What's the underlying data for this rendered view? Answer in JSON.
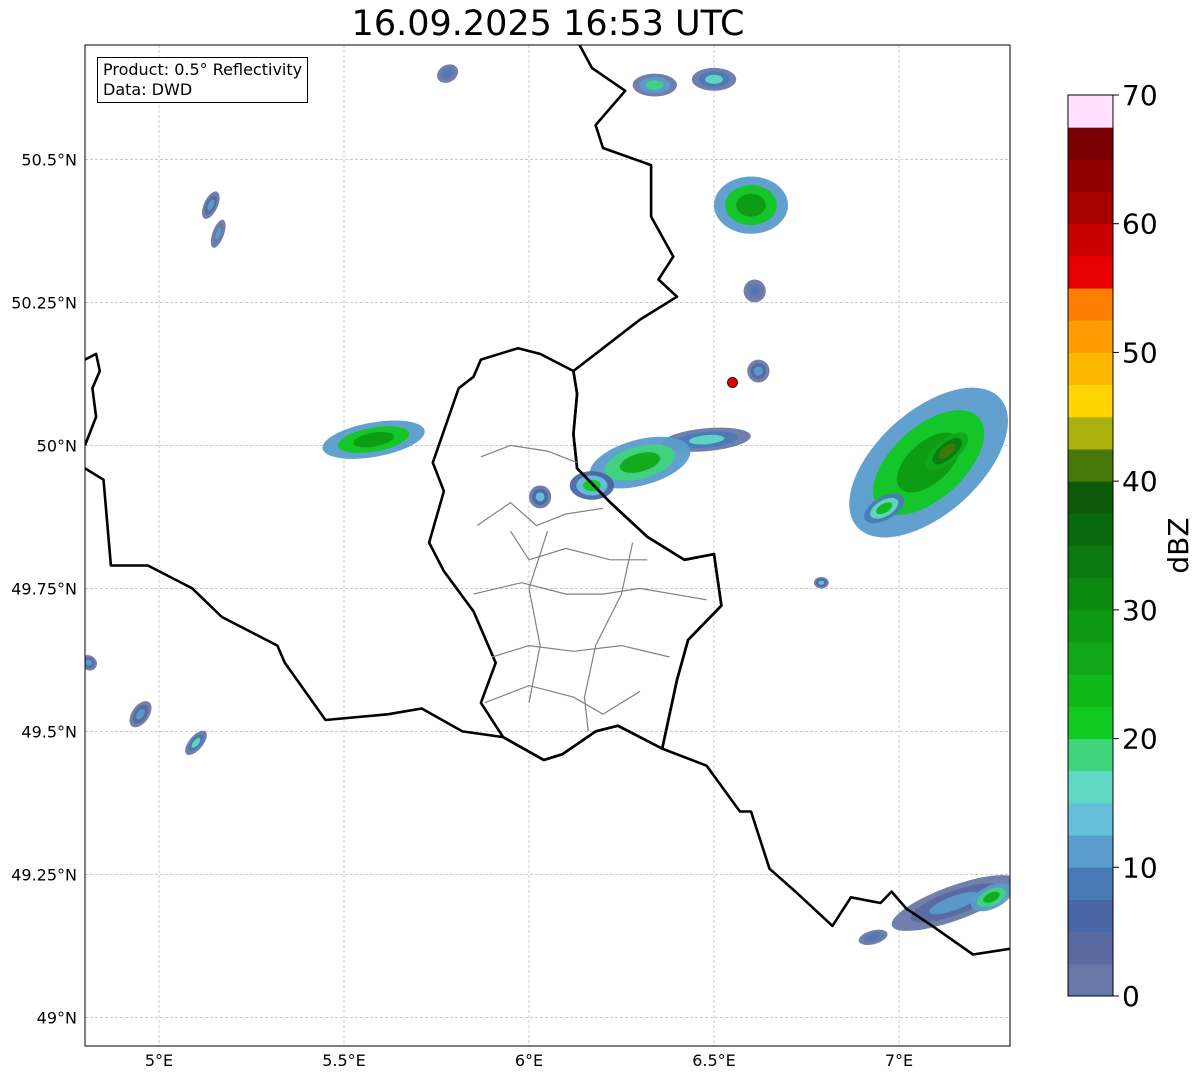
{
  "title": "16.09.2025 16:53 UTC",
  "info": {
    "product_line": "Product: 0.5° Reflectivity",
    "data_line": "Data: DWD"
  },
  "map": {
    "lon_range": [
      4.8,
      7.3
    ],
    "lat_range": [
      48.95,
      50.7
    ],
    "lat_ticks": [
      {
        "value": 49.0,
        "label": "49°N"
      },
      {
        "value": 49.25,
        "label": "49.25°N"
      },
      {
        "value": 49.5,
        "label": "49.5°N"
      },
      {
        "value": 49.75,
        "label": "49.75°N"
      },
      {
        "value": 50.0,
        "label": "50°N"
      },
      {
        "value": 50.25,
        "label": "50.25°N"
      },
      {
        "value": 50.5,
        "label": "50.5°N"
      }
    ],
    "lon_ticks": [
      {
        "value": 5.0,
        "label": "5°E"
      },
      {
        "value": 5.5,
        "label": "5.5°E"
      },
      {
        "value": 6.0,
        "label": "6°E"
      },
      {
        "value": 6.5,
        "label": "6.5°E"
      },
      {
        "value": 7.0,
        "label": "7°E"
      }
    ],
    "radar_site": {
      "lon": 6.55,
      "lat": 50.11,
      "color": "#e00000"
    },
    "echoes": [
      {
        "lon": 5.78,
        "lat": 50.65,
        "rx": 0.03,
        "ry": 0.015,
        "angle": -30,
        "dbz": 8
      },
      {
        "lon": 6.34,
        "lat": 50.63,
        "rx": 0.06,
        "ry": 0.02,
        "angle": 0,
        "dbz": 18
      },
      {
        "lon": 6.5,
        "lat": 50.64,
        "rx": 0.06,
        "ry": 0.02,
        "angle": 0,
        "dbz": 16
      },
      {
        "lon": 5.14,
        "lat": 50.42,
        "rx": 0.04,
        "ry": 0.012,
        "angle": -65,
        "dbz": 12
      },
      {
        "lon": 5.16,
        "lat": 50.37,
        "rx": 0.04,
        "ry": 0.01,
        "angle": -70,
        "dbz": 10
      },
      {
        "lon": 6.6,
        "lat": 50.42,
        "rx": 0.1,
        "ry": 0.05,
        "angle": 0,
        "dbz": 28
      },
      {
        "lon": 6.61,
        "lat": 50.27,
        "rx": 0.03,
        "ry": 0.02,
        "angle": 0,
        "dbz": 8
      },
      {
        "lon": 6.62,
        "lat": 50.13,
        "rx": 0.03,
        "ry": 0.02,
        "angle": 0,
        "dbz": 12
      },
      {
        "lon": 5.58,
        "lat": 50.01,
        "rx": 0.14,
        "ry": 0.03,
        "angle": -10,
        "dbz": 28
      },
      {
        "lon": 6.48,
        "lat": 50.01,
        "rx": 0.12,
        "ry": 0.02,
        "angle": -5,
        "dbz": 16
      },
      {
        "lon": 6.3,
        "lat": 49.97,
        "rx": 0.14,
        "ry": 0.04,
        "angle": -15,
        "dbz": 26
      },
      {
        "lon": 6.03,
        "lat": 49.91,
        "rx": 0.03,
        "ry": 0.02,
        "angle": 0,
        "dbz": 14
      },
      {
        "lon": 6.17,
        "lat": 49.93,
        "rx": 0.06,
        "ry": 0.025,
        "angle": 0,
        "dbz": 22
      },
      {
        "lon": 7.08,
        "lat": 49.97,
        "rx": 0.26,
        "ry": 0.09,
        "angle": -42,
        "dbz": 28
      },
      {
        "lon": 7.13,
        "lat": 49.99,
        "rx": 0.07,
        "ry": 0.02,
        "angle": -40,
        "dbz": 42
      },
      {
        "lon": 6.96,
        "lat": 49.89,
        "rx": 0.06,
        "ry": 0.02,
        "angle": -30,
        "dbz": 24
      },
      {
        "lon": 6.79,
        "lat": 49.76,
        "rx": 0.02,
        "ry": 0.01,
        "angle": 0,
        "dbz": 14
      },
      {
        "lon": 4.81,
        "lat": 49.62,
        "rx": 0.02,
        "ry": 0.015,
        "angle": -60,
        "dbz": 12
      },
      {
        "lon": 4.95,
        "lat": 49.53,
        "rx": 0.04,
        "ry": 0.015,
        "angle": -55,
        "dbz": 12
      },
      {
        "lon": 5.1,
        "lat": 49.48,
        "rx": 0.04,
        "ry": 0.012,
        "angle": -50,
        "dbz": 16
      },
      {
        "lon": 7.15,
        "lat": 49.2,
        "rx": 0.18,
        "ry": 0.03,
        "angle": -20,
        "dbz": 12
      },
      {
        "lon": 7.25,
        "lat": 49.21,
        "rx": 0.06,
        "ry": 0.02,
        "angle": -25,
        "dbz": 26
      },
      {
        "lon": 6.93,
        "lat": 49.14,
        "rx": 0.04,
        "ry": 0.012,
        "angle": -15,
        "dbz": 8
      }
    ],
    "country_borders": [
      [
        [
          6.12,
          50.72
        ],
        [
          6.17,
          50.66
        ],
        [
          6.26,
          50.62
        ],
        [
          6.18,
          50.56
        ],
        [
          6.2,
          50.52
        ],
        [
          6.33,
          50.49
        ],
        [
          6.33,
          50.4
        ],
        [
          6.39,
          50.33
        ],
        [
          6.35,
          50.29
        ],
        [
          6.4,
          50.26
        ],
        [
          6.3,
          50.22
        ],
        [
          6.2,
          50.17
        ],
        [
          6.12,
          50.13
        ],
        [
          6.13,
          50.09
        ],
        [
          6.12,
          50.02
        ],
        [
          6.13,
          49.96
        ],
        [
          6.22,
          49.9
        ],
        [
          6.32,
          49.84
        ],
        [
          6.42,
          49.8
        ],
        [
          6.5,
          49.81
        ],
        [
          6.52,
          49.72
        ],
        [
          6.43,
          49.66
        ],
        [
          6.4,
          49.59
        ],
        [
          6.36,
          49.47
        ],
        [
          6.48,
          49.44
        ],
        [
          6.57,
          49.36
        ],
        [
          6.6,
          49.36
        ],
        [
          6.65,
          49.26
        ],
        [
          6.72,
          49.22
        ],
        [
          6.82,
          49.16
        ],
        [
          6.87,
          49.21
        ],
        [
          6.95,
          49.2
        ],
        [
          6.98,
          49.22
        ],
        [
          7.02,
          49.19
        ],
        [
          7.09,
          49.16
        ],
        [
          7.2,
          49.11
        ],
        [
          7.3,
          49.12
        ]
      ],
      [
        [
          4.8,
          49.96
        ],
        [
          4.85,
          49.94
        ],
        [
          4.87,
          49.79
        ],
        [
          4.97,
          49.79
        ],
        [
          5.09,
          49.75
        ],
        [
          5.17,
          49.7
        ],
        [
          5.32,
          49.65
        ],
        [
          5.34,
          49.62
        ],
        [
          5.45,
          49.52
        ],
        [
          5.62,
          49.53
        ],
        [
          5.71,
          49.54
        ],
        [
          5.82,
          49.5
        ],
        [
          5.93,
          49.49
        ],
        [
          6.04,
          49.45
        ],
        [
          6.09,
          49.46
        ],
        [
          6.18,
          49.5
        ],
        [
          6.24,
          49.51
        ],
        [
          6.36,
          49.47
        ]
      ],
      [
        [
          4.8,
          50.15
        ],
        [
          4.83,
          50.16
        ],
        [
          4.84,
          50.13
        ],
        [
          4.82,
          50.1
        ],
        [
          4.83,
          50.05
        ],
        [
          4.8,
          50.0
        ]
      ]
    ],
    "luxembourg_outline": [
      [
        5.81,
        50.1
      ],
      [
        5.85,
        50.12
      ],
      [
        5.87,
        50.15
      ],
      [
        5.97,
        50.17
      ],
      [
        6.03,
        50.16
      ],
      [
        6.12,
        50.13
      ],
      [
        6.13,
        50.09
      ],
      [
        6.12,
        50.02
      ],
      [
        6.13,
        49.96
      ],
      [
        6.22,
        49.9
      ],
      [
        6.32,
        49.84
      ],
      [
        6.42,
        49.8
      ],
      [
        6.5,
        49.81
      ],
      [
        6.52,
        49.72
      ],
      [
        6.43,
        49.66
      ],
      [
        6.4,
        49.59
      ],
      [
        6.36,
        49.47
      ],
      [
        6.24,
        49.51
      ],
      [
        6.18,
        49.5
      ],
      [
        6.09,
        49.46
      ],
      [
        6.04,
        49.45
      ],
      [
        5.93,
        49.49
      ],
      [
        5.87,
        49.55
      ],
      [
        5.91,
        49.62
      ],
      [
        5.85,
        49.71
      ],
      [
        5.77,
        49.78
      ],
      [
        5.73,
        49.83
      ],
      [
        5.77,
        49.92
      ],
      [
        5.74,
        49.97
      ],
      [
        5.81,
        50.1
      ]
    ],
    "admin_lines": [
      [
        [
          5.86,
          49.86
        ],
        [
          5.95,
          49.9
        ],
        [
          6.02,
          49.86
        ],
        [
          6.1,
          49.88
        ],
        [
          6.2,
          49.89
        ]
      ],
      [
        [
          5.87,
          49.98
        ],
        [
          5.95,
          50.0
        ],
        [
          6.05,
          49.99
        ],
        [
          6.13,
          49.97
        ]
      ],
      [
        [
          5.95,
          49.85
        ],
        [
          6.0,
          49.8
        ],
        [
          6.1,
          49.82
        ],
        [
          6.22,
          49.8
        ],
        [
          6.32,
          49.8
        ]
      ],
      [
        [
          5.85,
          49.74
        ],
        [
          5.98,
          49.76
        ],
        [
          6.1,
          49.74
        ],
        [
          6.2,
          49.74
        ],
        [
          6.3,
          49.75
        ],
        [
          6.48,
          49.73
        ]
      ],
      [
        [
          5.9,
          49.63
        ],
        [
          6.0,
          49.65
        ],
        [
          6.12,
          49.64
        ],
        [
          6.25,
          49.65
        ],
        [
          6.38,
          49.63
        ]
      ],
      [
        [
          5.88,
          49.55
        ],
        [
          6.0,
          49.58
        ],
        [
          6.12,
          49.56
        ],
        [
          6.2,
          49.53
        ],
        [
          6.3,
          49.57
        ]
      ],
      [
        [
          6.05,
          49.85
        ],
        [
          6.0,
          49.75
        ],
        [
          6.03,
          49.65
        ],
        [
          6.0,
          49.55
        ]
      ],
      [
        [
          6.28,
          49.83
        ],
        [
          6.25,
          49.74
        ],
        [
          6.18,
          49.65
        ],
        [
          6.15,
          49.56
        ],
        [
          6.16,
          49.5
        ]
      ]
    ]
  },
  "colorbar": {
    "label": "dBZ",
    "min": 0,
    "max": 70,
    "step": 2.5,
    "ticks": [
      {
        "value": 0,
        "label": "0"
      },
      {
        "value": 10,
        "label": "10"
      },
      {
        "value": 20,
        "label": "20"
      },
      {
        "value": 30,
        "label": "30"
      },
      {
        "value": 40,
        "label": "40"
      },
      {
        "value": 50,
        "label": "50"
      },
      {
        "value": 60,
        "label": "60"
      },
      {
        "value": 70,
        "label": "70"
      }
    ],
    "colors": [
      "#6878a8",
      "#5a6aa0",
      "#4a66a6",
      "#4a7ab6",
      "#5a9ccc",
      "#66c0dc",
      "#60d8c4",
      "#40d47c",
      "#10c820",
      "#10b818",
      "#10a818",
      "#0e9a14",
      "#0c8a10",
      "#0a7a10",
      "#086a0c",
      "#0a5a08",
      "#48780a",
      "#acb00c",
      "#ffd400",
      "#ffb800",
      "#ff9c00",
      "#ff8000",
      "#e80000",
      "#c80000",
      "#a80000",
      "#900000",
      "#780000",
      "#ffe0ff",
      "#ffb0ff",
      "#ff70ff",
      "#ee3cee"
    ]
  }
}
